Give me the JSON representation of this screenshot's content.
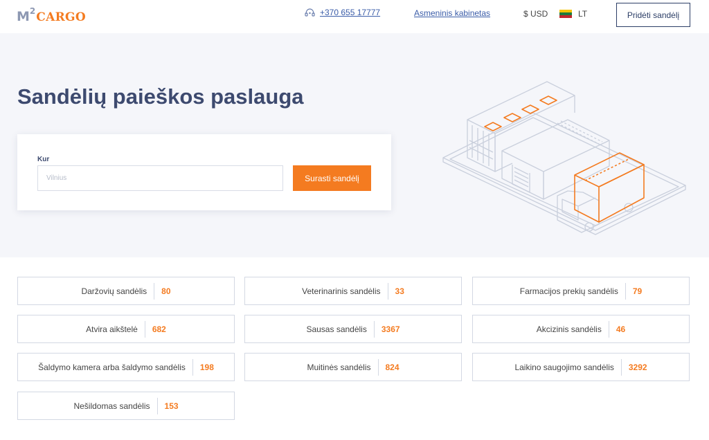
{
  "header": {
    "logo_m": "M",
    "logo_sup": "2",
    "logo_cargo": "CARGO",
    "phone": "+370 655 17777",
    "account_link": "Asmeninis kabinetas",
    "currency": "$ USD",
    "language": "LT",
    "add_button": "Pridėti sandėlį"
  },
  "hero": {
    "title": "Sandėlių paieškos paslauga",
    "search_label": "Kur",
    "search_placeholder": "Vilnius",
    "search_button": "Surasti sandėlį"
  },
  "categories": [
    {
      "name": "Daržovių sandėlis",
      "count": "80"
    },
    {
      "name": "Veterinarinis sandėlis",
      "count": "33"
    },
    {
      "name": "Farmacijos prekių sandėlis",
      "count": "79"
    },
    {
      "name": "Atvira aikštelė",
      "count": "682"
    },
    {
      "name": "Sausas sandėlis",
      "count": "3367"
    },
    {
      "name": "Akcizinis sandėlis",
      "count": "46"
    },
    {
      "name": "Šaldymo kamera arba šaldymo sandėlis",
      "count": "198"
    },
    {
      "name": "Muitinės sandėlis",
      "count": "824"
    },
    {
      "name": "Laikino saugojimo sandėlis",
      "count": "3292"
    },
    {
      "name": "Nešildomas sandėlis",
      "count": "153"
    }
  ],
  "colors": {
    "accent": "#f47b20",
    "navy": "#3d4a6f",
    "link": "#3a5ca8",
    "hero_bg": "#f5f6fa"
  },
  "icons": {
    "phone": "phone-icon",
    "flag": "lithuania-flag-icon",
    "illustration": "warehouse-truck-illustration"
  }
}
